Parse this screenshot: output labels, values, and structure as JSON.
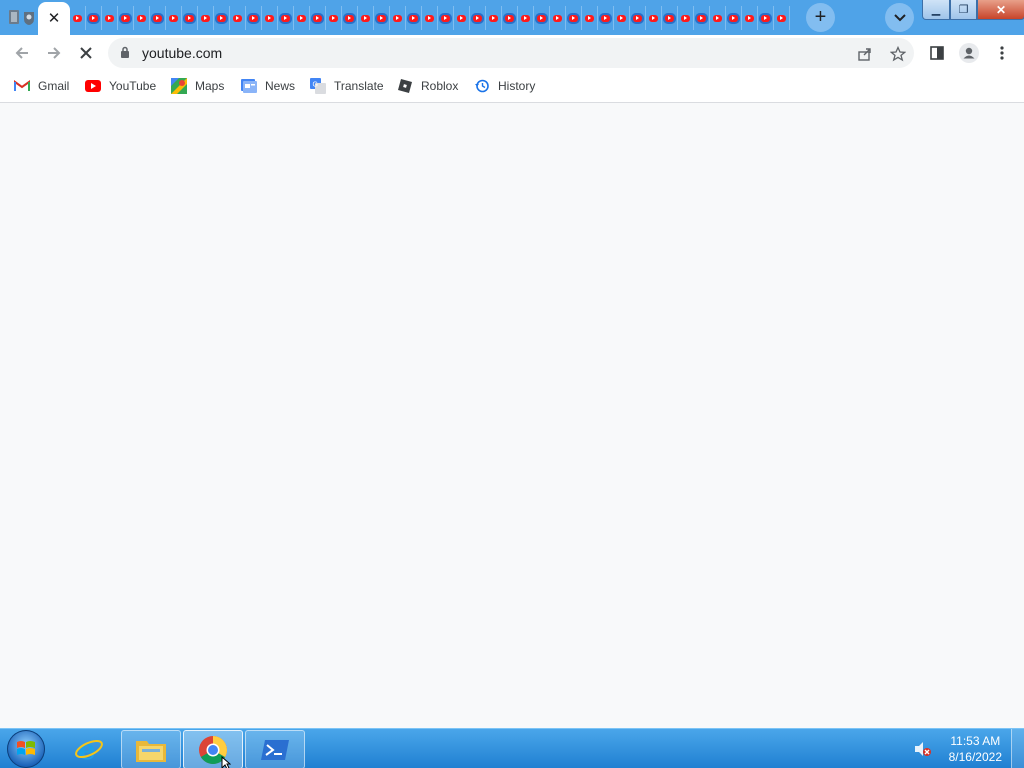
{
  "browser": {
    "tab_count_mini": 48,
    "address": "youtube.com",
    "new_tab_label": "+",
    "active_tab_close": "✕"
  },
  "bookmarks": [
    {
      "label": "Gmail",
      "icon": "gmail-icon"
    },
    {
      "label": "YouTube",
      "icon": "youtube-icon"
    },
    {
      "label": "Maps",
      "icon": "maps-icon"
    },
    {
      "label": "News",
      "icon": "news-icon"
    },
    {
      "label": "Translate",
      "icon": "translate-icon"
    },
    {
      "label": "Roblox",
      "icon": "roblox-icon"
    },
    {
      "label": "History",
      "icon": "history-icon"
    }
  ],
  "taskbar": {
    "time": "11:53 AM",
    "date": "8/16/2022",
    "items": [
      "internet-explorer",
      "file-explorer",
      "chrome",
      "powershell"
    ]
  },
  "colors": {
    "tabstrip": "#4fa3e8",
    "youtube_red": "#ff0000",
    "taskbar": "#1f7fd1"
  }
}
